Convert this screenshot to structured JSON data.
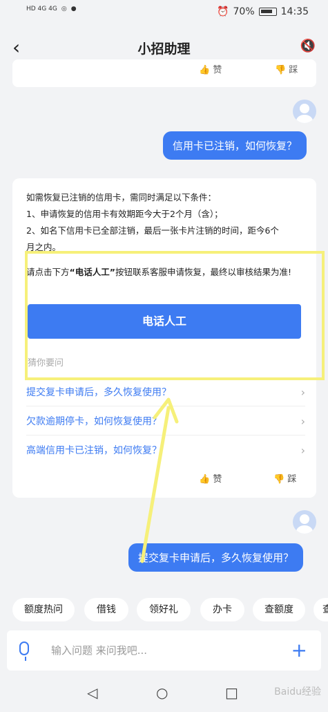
{
  "status": {
    "left": "HD 4G 4G",
    "battery": "70%",
    "time": "14:35"
  },
  "header": {
    "title": "小招助理",
    "back_icon": "chevron-left-icon",
    "sound_icon": "speaker-mute-icon"
  },
  "prev_card": {
    "like": "赞",
    "dislike": "踩"
  },
  "user_msg_1": "信用卡已注销，如何恢复？",
  "answer": {
    "line1": "如需恢复已注销的信用卡，需同时满足以下条件：",
    "line2": "1、申请恢复的信用卡有效期距今大于2个月（含）；",
    "line3": "2、如名下信用卡已全部注销，最后一张卡片注销的时间，距今6个",
    "line4": "月之内。",
    "para2_pre": "请点击下方",
    "para2_bold": "“电话人工”",
    "para2_post": "按钮联系客服申请恢复，最终以审核结果为准!",
    "button": "电话人工",
    "ask_hint": "猜你要问",
    "questions": [
      "提交复卡申请后，多久恢复使用？",
      "欠款逾期停卡，如何恢复使用？",
      "高端信用卡已注销，如何恢复？"
    ],
    "like": "赞",
    "dislike": "踩"
  },
  "user_msg_2": "提交复卡申请后，多久恢复使用？",
  "chips": [
    "额度热问",
    "借钱",
    "领好礼",
    "办卡",
    "查额度",
    "查"
  ],
  "input": {
    "placeholder": "输入问题 来问我吧..."
  },
  "watermark": "Baidu经验",
  "colors": {
    "accent": "#3d7bf2",
    "highlight": "#f6f07a"
  }
}
